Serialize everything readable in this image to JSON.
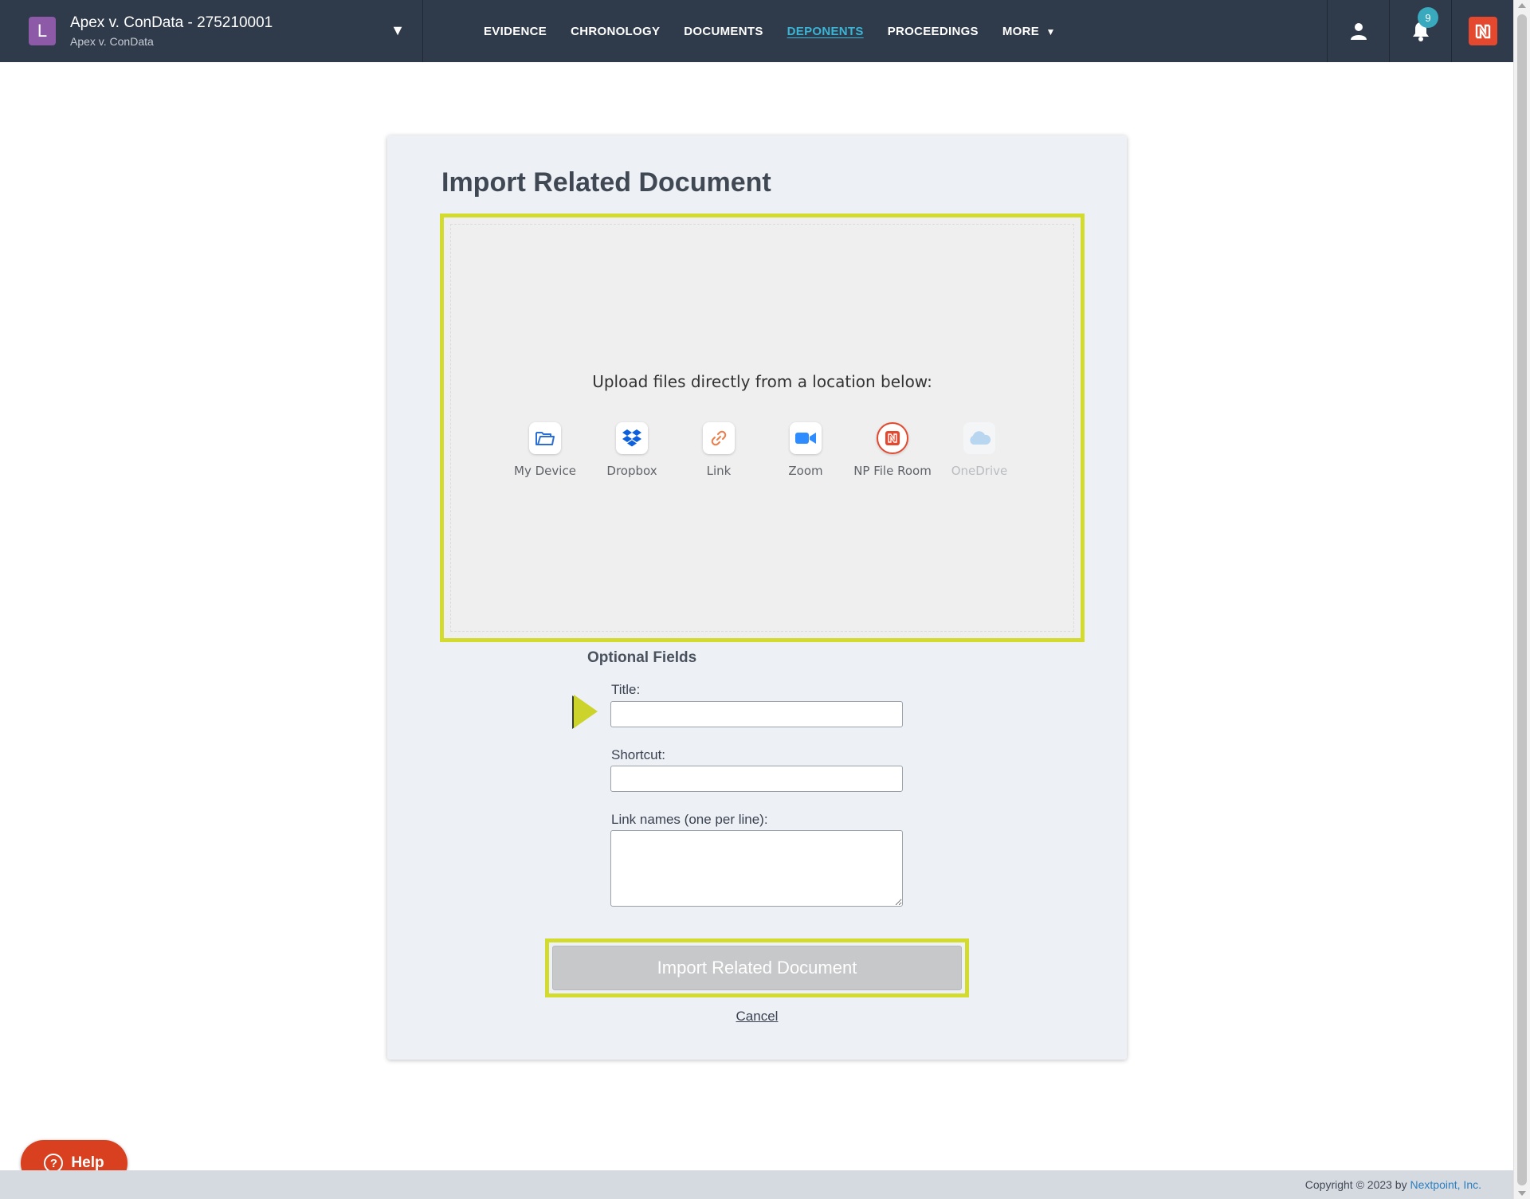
{
  "header": {
    "case_initial": "L",
    "case_title": "Apex v. ConData - 275210001",
    "case_subtitle": "Apex v. ConData",
    "case_toggle": "▼",
    "nav": [
      {
        "label": "EVIDENCE",
        "active": false
      },
      {
        "label": "CHRONOLOGY",
        "active": false
      },
      {
        "label": "DOCUMENTS",
        "active": false
      },
      {
        "label": "DEPONENTS",
        "active": true
      },
      {
        "label": "PROCEEDINGS",
        "active": false
      },
      {
        "label": "MORE",
        "active": false
      }
    ],
    "more_caret": "▼",
    "notification_count": "9",
    "icons": [
      "user-icon",
      "bell-icon",
      "nextpoint-logo-icon"
    ]
  },
  "page": {
    "title": "Import Related Document"
  },
  "upload": {
    "prompt": "Upload files directly from a location below:",
    "sources": [
      {
        "label": "My Device",
        "icon": "folder-icon",
        "disabled": false
      },
      {
        "label": "Dropbox",
        "icon": "dropbox-icon",
        "disabled": false
      },
      {
        "label": "Link",
        "icon": "link-icon",
        "disabled": false
      },
      {
        "label": "Zoom",
        "icon": "zoom-icon",
        "disabled": false
      },
      {
        "label": "NP File Room",
        "icon": "np-file-room-icon",
        "disabled": false
      },
      {
        "label": "OneDrive",
        "icon": "onedrive-icon",
        "disabled": true
      }
    ]
  },
  "form": {
    "optional_title": "Optional Fields",
    "title_label": "Title:",
    "title_value": "",
    "shortcut_label": "Shortcut:",
    "shortcut_value": "",
    "links_label": "Link names (one per line):",
    "links_value": "",
    "submit_label": "Import Related Document",
    "cancel_label": "Cancel"
  },
  "help": {
    "label": "Help",
    "icon_glyph": "?"
  },
  "footer": {
    "copyright": "Copyright © 2023 by ",
    "company": "Nextpoint, Inc."
  },
  "colors": {
    "topbar": "#2f3a4b",
    "active_nav": "#3ab5d6",
    "highlight": "#d3dc2e",
    "help": "#d8401f",
    "brand": "#e4492f"
  }
}
